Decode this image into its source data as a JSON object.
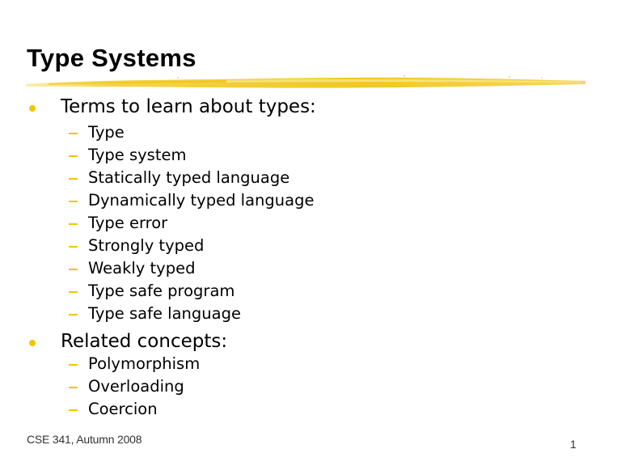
{
  "slide": {
    "title": "Type Systems",
    "accent_color": "#f5c400",
    "sections": [
      {
        "heading": "Terms to learn about types:",
        "items": [
          "Type",
          "Type system",
          "Statically typed language",
          "Dynamically typed language",
          "Type error",
          "Strongly typed",
          "Weakly typed",
          "Type safe program",
          "Type safe language"
        ]
      },
      {
        "heading": "Related concepts:",
        "items": [
          "Polymorphism",
          "Overloading",
          "Coercion"
        ]
      }
    ],
    "footer": {
      "course": "CSE 341, Autumn 2008",
      "page_number": "1"
    }
  }
}
